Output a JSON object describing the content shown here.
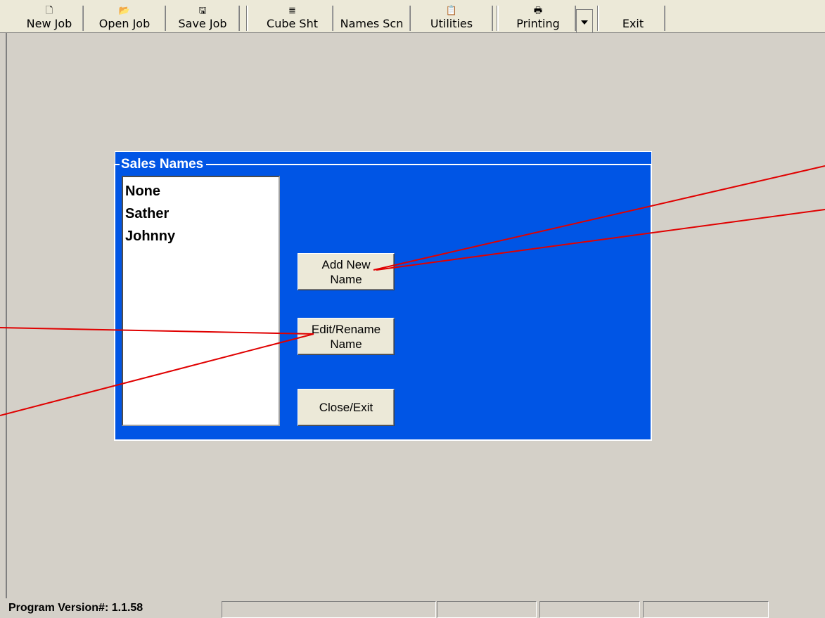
{
  "toolbar": {
    "new_job": "New Job",
    "open_job": "Open Job",
    "save_job": "Save Job",
    "cube_sht": "Cube Sht",
    "names_scn": "Names Scn",
    "utilities": "Utilities",
    "printing": "Printing",
    "exit": "Exit"
  },
  "icons": {
    "new_job": "new-document-icon",
    "open_job": "open-folder-icon",
    "save_job": "floppy-disk-icon",
    "cube_sht": "lines-icon",
    "utilities": "clipboard-icon",
    "printing": "printer-icon",
    "dropdown": "dropdown-arrow-icon"
  },
  "dialog": {
    "title": "Sales Names",
    "names": [
      "None",
      "Sather",
      "Johnny"
    ],
    "add_line1": "Add New",
    "add_line2": "Name",
    "edit_line1": "Edit/Rename",
    "edit_line2": "Name",
    "close": "Close/Exit"
  },
  "status": {
    "version": "Program Version#: 1.1.58"
  },
  "colors": {
    "dialog_bg": "#0055e5",
    "annotation": "#e00000",
    "workspace": "#d4d0c8"
  }
}
